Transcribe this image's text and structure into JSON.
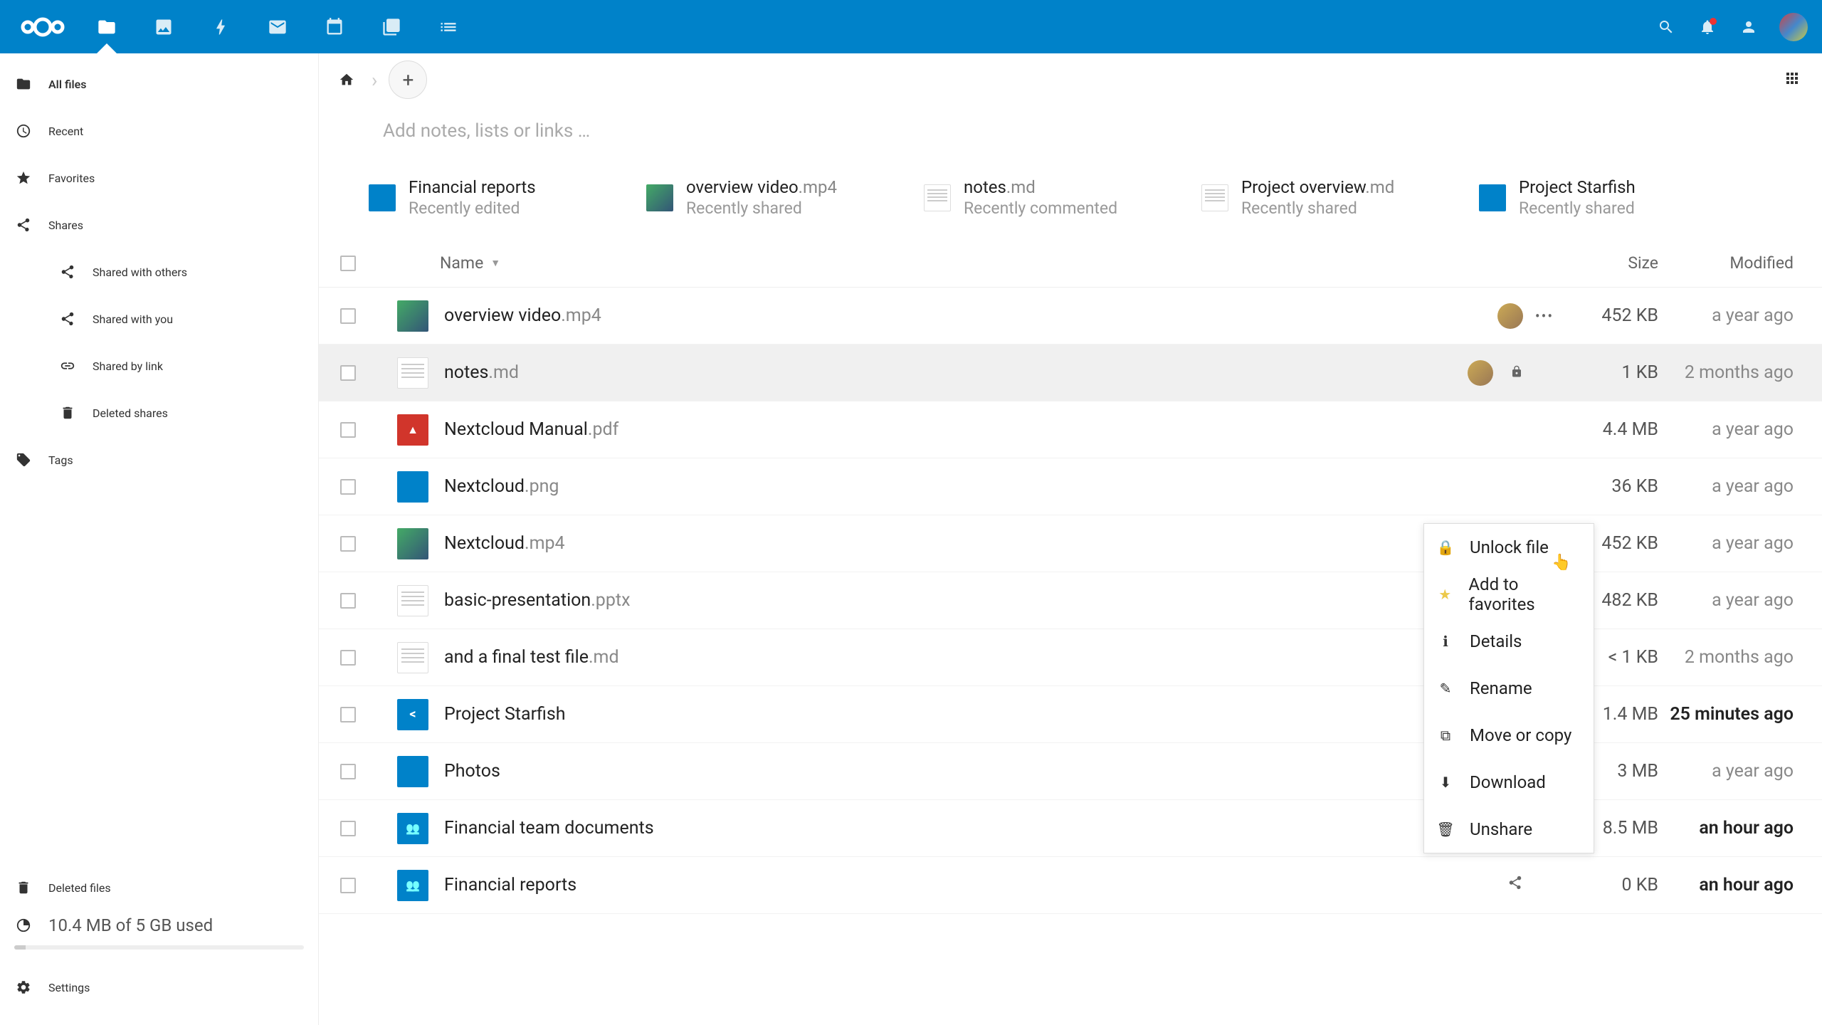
{
  "header": {
    "apps": [
      "files",
      "gallery",
      "activity",
      "mail",
      "calendar",
      "deck",
      "tasks"
    ]
  },
  "sidebar": {
    "items": [
      {
        "label": "All files",
        "icon": "folder",
        "active": true
      },
      {
        "label": "Recent",
        "icon": "clock"
      },
      {
        "label": "Favorites",
        "icon": "star"
      },
      {
        "label": "Shares",
        "icon": "share"
      },
      {
        "label": "Shared with others",
        "icon": "share",
        "sub": true
      },
      {
        "label": "Shared with you",
        "icon": "share",
        "sub": true
      },
      {
        "label": "Shared by link",
        "icon": "link",
        "sub": true
      },
      {
        "label": "Deleted shares",
        "icon": "trash",
        "sub": true
      },
      {
        "label": "Tags",
        "icon": "tag"
      }
    ],
    "deleted": "Deleted files",
    "quota": "10.4 MB of 5 GB used",
    "settings": "Settings"
  },
  "notes_placeholder": "Add notes, lists or links …",
  "recommendations": [
    {
      "name": "Financial reports",
      "ext": "",
      "sub": "Recently edited",
      "type": "folder"
    },
    {
      "name": "overview video",
      "ext": ".mp4",
      "sub": "Recently shared",
      "type": "video"
    },
    {
      "name": "notes",
      "ext": ".md",
      "sub": "Recently commented",
      "type": "doc"
    },
    {
      "name": "Project overview",
      "ext": ".md",
      "sub": "Recently shared",
      "type": "doc"
    },
    {
      "name": "Project Starfish",
      "ext": "",
      "sub": "Recently shared",
      "type": "folder"
    }
  ],
  "columns": {
    "name": "Name",
    "size": "Size",
    "modified": "Modified"
  },
  "rows": [
    {
      "name": "overview video",
      "ext": ".mp4",
      "type": "video",
      "avatar": true,
      "actions": true,
      "size": "452 KB",
      "mod": "a year ago"
    },
    {
      "name": "notes",
      "ext": ".md",
      "type": "doc",
      "avatar": true,
      "lock": true,
      "size": "1 KB",
      "mod": "2 months ago",
      "selected": true
    },
    {
      "name": "Nextcloud Manual",
      "ext": ".pdf",
      "type": "pdf",
      "size": "4.4 MB",
      "mod": "a year ago"
    },
    {
      "name": "Nextcloud",
      "ext": ".png",
      "type": "png",
      "size": "36 KB",
      "mod": "a year ago"
    },
    {
      "name": "Nextcloud",
      "ext": ".mp4",
      "type": "video",
      "size": "452 KB",
      "mod": "a year ago"
    },
    {
      "name": "basic-presentation",
      "ext": ".pptx",
      "type": "doc",
      "size": "482 KB",
      "mod": "a year ago"
    },
    {
      "name": "and a final test file",
      "ext": ".md",
      "type": "doc",
      "size": "< 1 KB",
      "mod": "2 months ago"
    },
    {
      "name": "Project Starfish",
      "ext": "",
      "type": "folder-share",
      "avatar": true,
      "size": "1.4 MB",
      "mod": "25 minutes ago",
      "modBold": true
    },
    {
      "name": "Photos",
      "ext": "",
      "type": "folder",
      "share": true,
      "actions": true,
      "size": "3 MB",
      "mod": "a year ago"
    },
    {
      "name": "Financial team documents",
      "ext": "",
      "type": "folder-team",
      "share": true,
      "actions": true,
      "size": "8.5 MB",
      "mod": "an hour ago",
      "modBold": true
    },
    {
      "name": "Financial reports",
      "ext": "",
      "type": "folder-team",
      "share": true,
      "size": "0 KB",
      "mod": "an hour ago",
      "modBold": true
    }
  ],
  "context_menu": [
    {
      "label": "Unlock file",
      "icon": "lock"
    },
    {
      "label": "Add to favorites",
      "icon": "star"
    },
    {
      "label": "Details",
      "icon": "info"
    },
    {
      "label": "Rename",
      "icon": "pencil"
    },
    {
      "label": "Move or copy",
      "icon": "external"
    },
    {
      "label": "Download",
      "icon": "download"
    },
    {
      "label": "Unshare",
      "icon": "trash"
    }
  ]
}
